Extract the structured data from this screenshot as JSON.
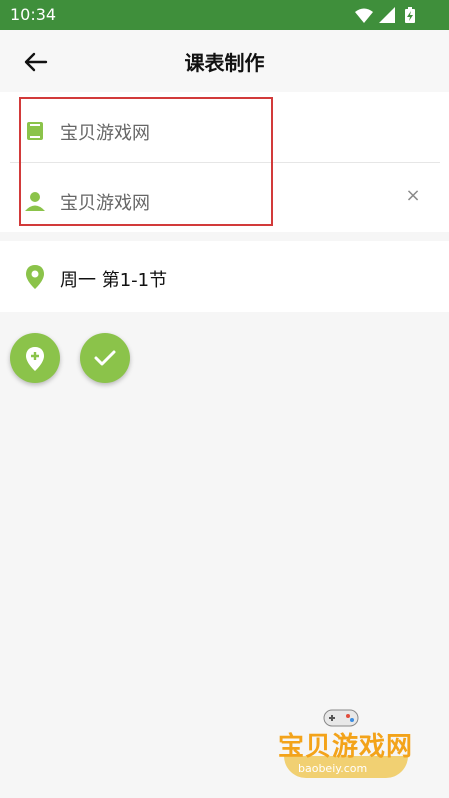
{
  "status_bar": {
    "time": "10:34",
    "icons": [
      "wifi-icon",
      "signal-icon",
      "battery-icon"
    ]
  },
  "app_bar": {
    "title": "课表制作",
    "back_icon": "arrow-left-icon"
  },
  "course_form": {
    "course_name": "宝贝游戏网",
    "teacher_name": "宝贝游戏网",
    "course_icon": "book-icon",
    "teacher_icon": "person-icon",
    "clear_label": "×"
  },
  "schedule": {
    "icon": "location-pin-icon",
    "label": "周一 第1-1节"
  },
  "actions": {
    "add_icon": "add-location-icon",
    "confirm_icon": "check-icon"
  },
  "watermark": {
    "text": "宝贝游戏网",
    "url": "baobeiy.com"
  },
  "colors": {
    "status_bar": "#3f8f3b",
    "accent": "#8bc34a",
    "highlight": "#d23a3a",
    "watermark": "#f3a31a"
  }
}
